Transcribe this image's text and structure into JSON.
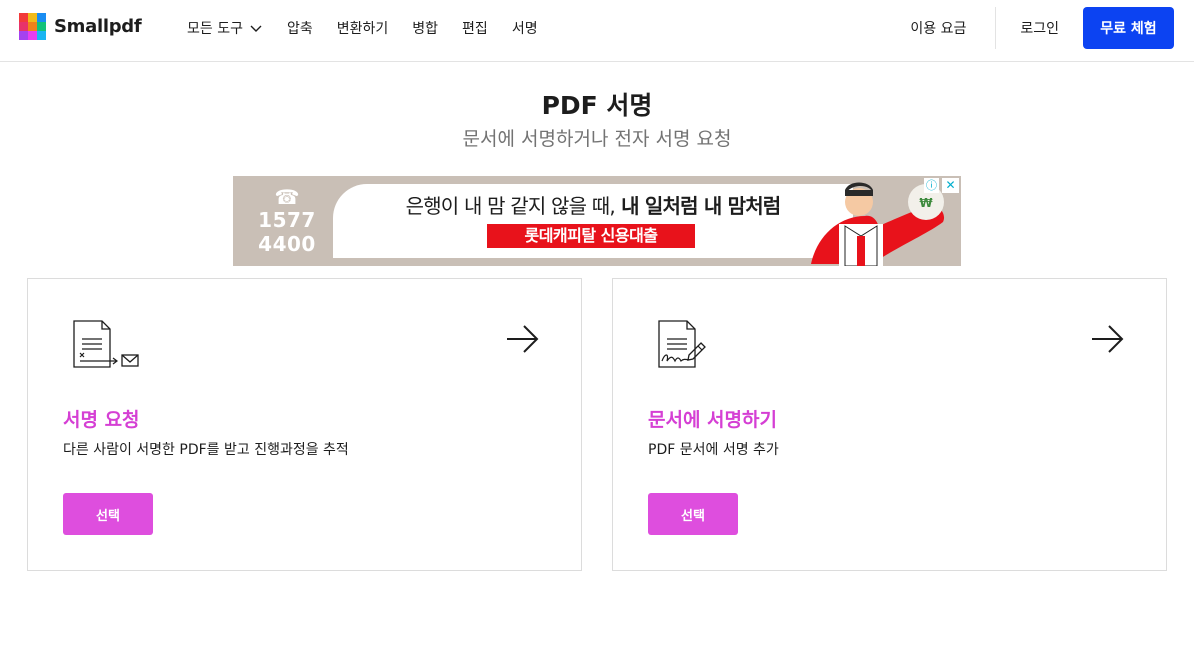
{
  "brand": {
    "name": "Smallpdf",
    "logo_colors": [
      "#f23a3a",
      "#f2bb1a",
      "#1a8df2",
      "#e8326a",
      "#f2821a",
      "#13c27a",
      "#a542f0",
      "#e83df0",
      "#1ab5f2"
    ]
  },
  "nav": {
    "items": [
      {
        "label": "모든 도구",
        "has_dropdown": true
      },
      {
        "label": "압축"
      },
      {
        "label": "변환하기"
      },
      {
        "label": "병합"
      },
      {
        "label": "편집"
      },
      {
        "label": "서명"
      }
    ],
    "pricing": "이용 요금",
    "login": "로그인",
    "trial": "무료 체험"
  },
  "page": {
    "title": "PDF 서명",
    "subtitle": "문서에 서명하거나 전자 서명 요청"
  },
  "ad": {
    "phone_line1": "1577",
    "phone_line2": "4400",
    "headline_regular": "은행이 내 맘 같지 않을 때,",
    "headline_bold": " 내 일처럼 내 맘처럼",
    "subline": "롯데캐피탈 신용대출",
    "info_icon": "ⓘ",
    "close_icon": "✕"
  },
  "cards": [
    {
      "title": "서명 요청",
      "description": "다른 사람이 서명한 PDF를 받고 진행과정을 추적",
      "button": "선택",
      "icon": "request-signature-icon"
    },
    {
      "title": "문서에 서명하기",
      "description": "PDF 문서에 서명 추가",
      "button": "선택",
      "icon": "sign-document-icon"
    }
  ],
  "colors": {
    "primary": "#0c43f2",
    "accent_title": "#d53fd4",
    "accent_button": "#de4ede",
    "ad_red": "#e8121b"
  }
}
